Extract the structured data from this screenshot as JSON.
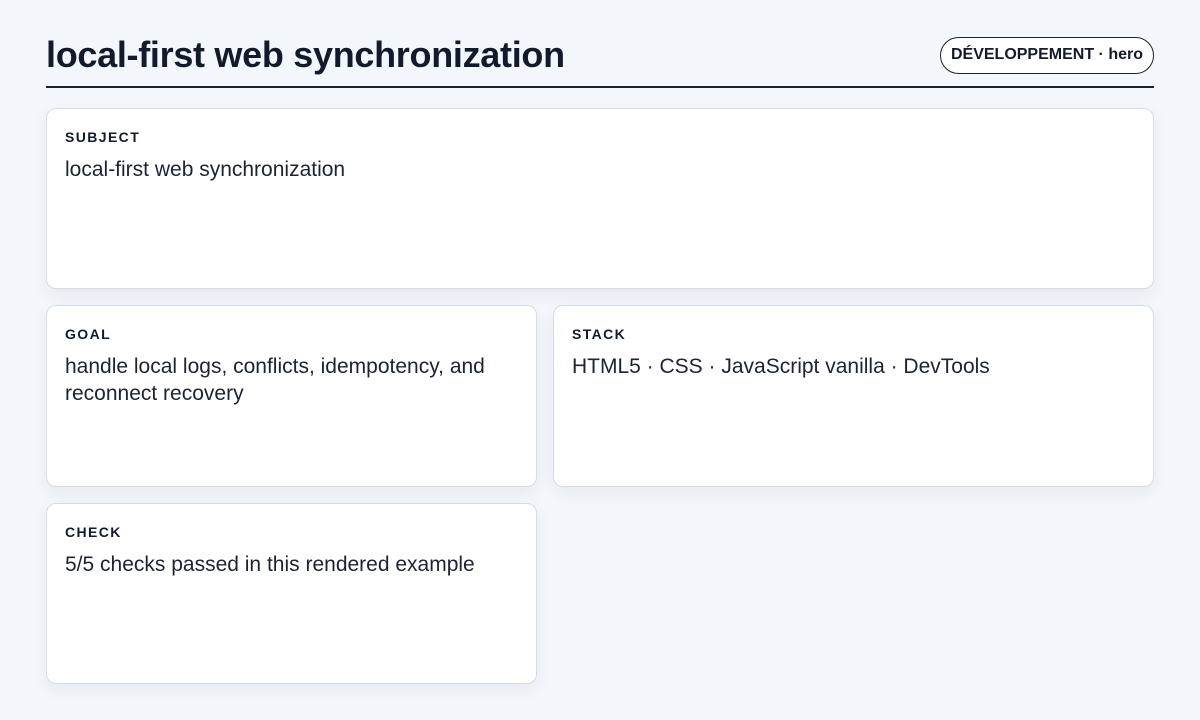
{
  "header": {
    "title": "local-first web synchronization",
    "badge": "DÉVELOPPEMENT · hero"
  },
  "cards": {
    "subject": {
      "label": "SUBJECT",
      "value": "local-first web synchronization"
    },
    "goal": {
      "label": "GOAL",
      "value": "handle local logs, conflicts, idempotency, and reconnect recovery"
    },
    "stack": {
      "label": "STACK",
      "value": "HTML5 · CSS · JavaScript vanilla · DevTools"
    },
    "check": {
      "label": "CHECK",
      "value": "5/5 checks passed in this rendered example"
    }
  },
  "colors": {
    "background": "#f3f6fa",
    "card": "#ffffff",
    "text": "#131a2b",
    "rule": "#1a2030"
  }
}
